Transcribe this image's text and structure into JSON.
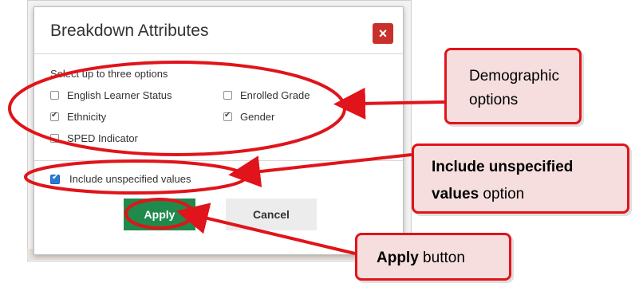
{
  "dialog": {
    "title": "Breakdown Attributes",
    "close_label": "×",
    "instruction": "Select up to three options",
    "options": [
      {
        "label": "English Learner Status",
        "checked": false
      },
      {
        "label": "Enrolled Grade",
        "checked": false
      },
      {
        "label": "Ethnicity",
        "checked": true
      },
      {
        "label": "Gender",
        "checked": true
      },
      {
        "label": "SPED Indicator",
        "checked": false
      }
    ],
    "include_unspecified": {
      "label": "Include unspecified values",
      "checked": true
    },
    "apply_label": "Apply",
    "cancel_label": "Cancel"
  },
  "callouts": {
    "demographic": {
      "line1": "Demographic",
      "line2": "options"
    },
    "unspecified": {
      "bold": "Include unspecified",
      "bold2": "values",
      "rest": " option"
    },
    "apply": {
      "bold": "Apply",
      "rest": " button"
    }
  },
  "colors": {
    "annotation_red": "#e0141a",
    "callout_fill": "#f6dede",
    "apply_green": "#1f8a4c",
    "close_red": "#c9302c",
    "checkbox_blue": "#2a78d6"
  }
}
